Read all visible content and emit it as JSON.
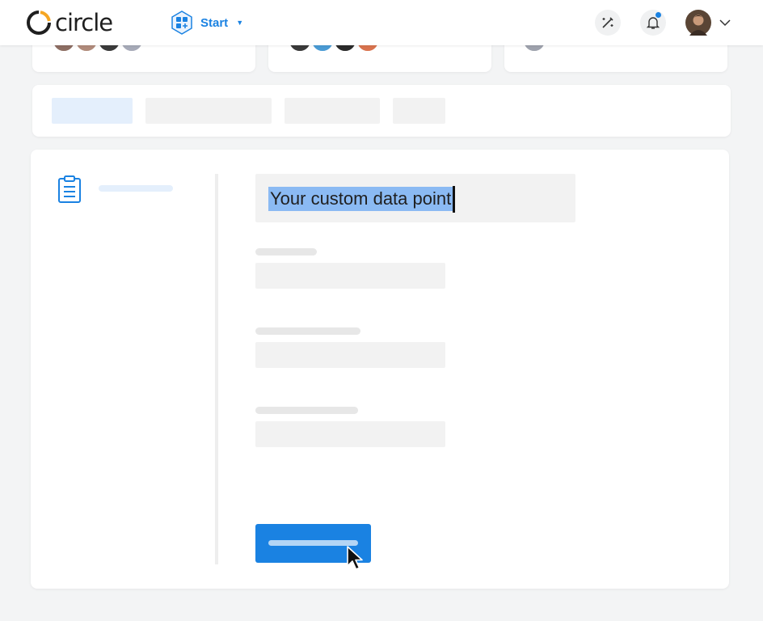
{
  "brand": {
    "logo_text": "circle",
    "accent": "#1a82e2"
  },
  "topbar": {
    "start_label": "Start",
    "tools_icon": "magic-wand-icon",
    "bell_icon": "bell-icon",
    "has_notification": true
  },
  "form": {
    "selected_value": "Your custom data point"
  },
  "colors": {
    "primary": "#1a82e2",
    "selection": "#8bbaf3",
    "skeleton": "#f2f2f2"
  }
}
